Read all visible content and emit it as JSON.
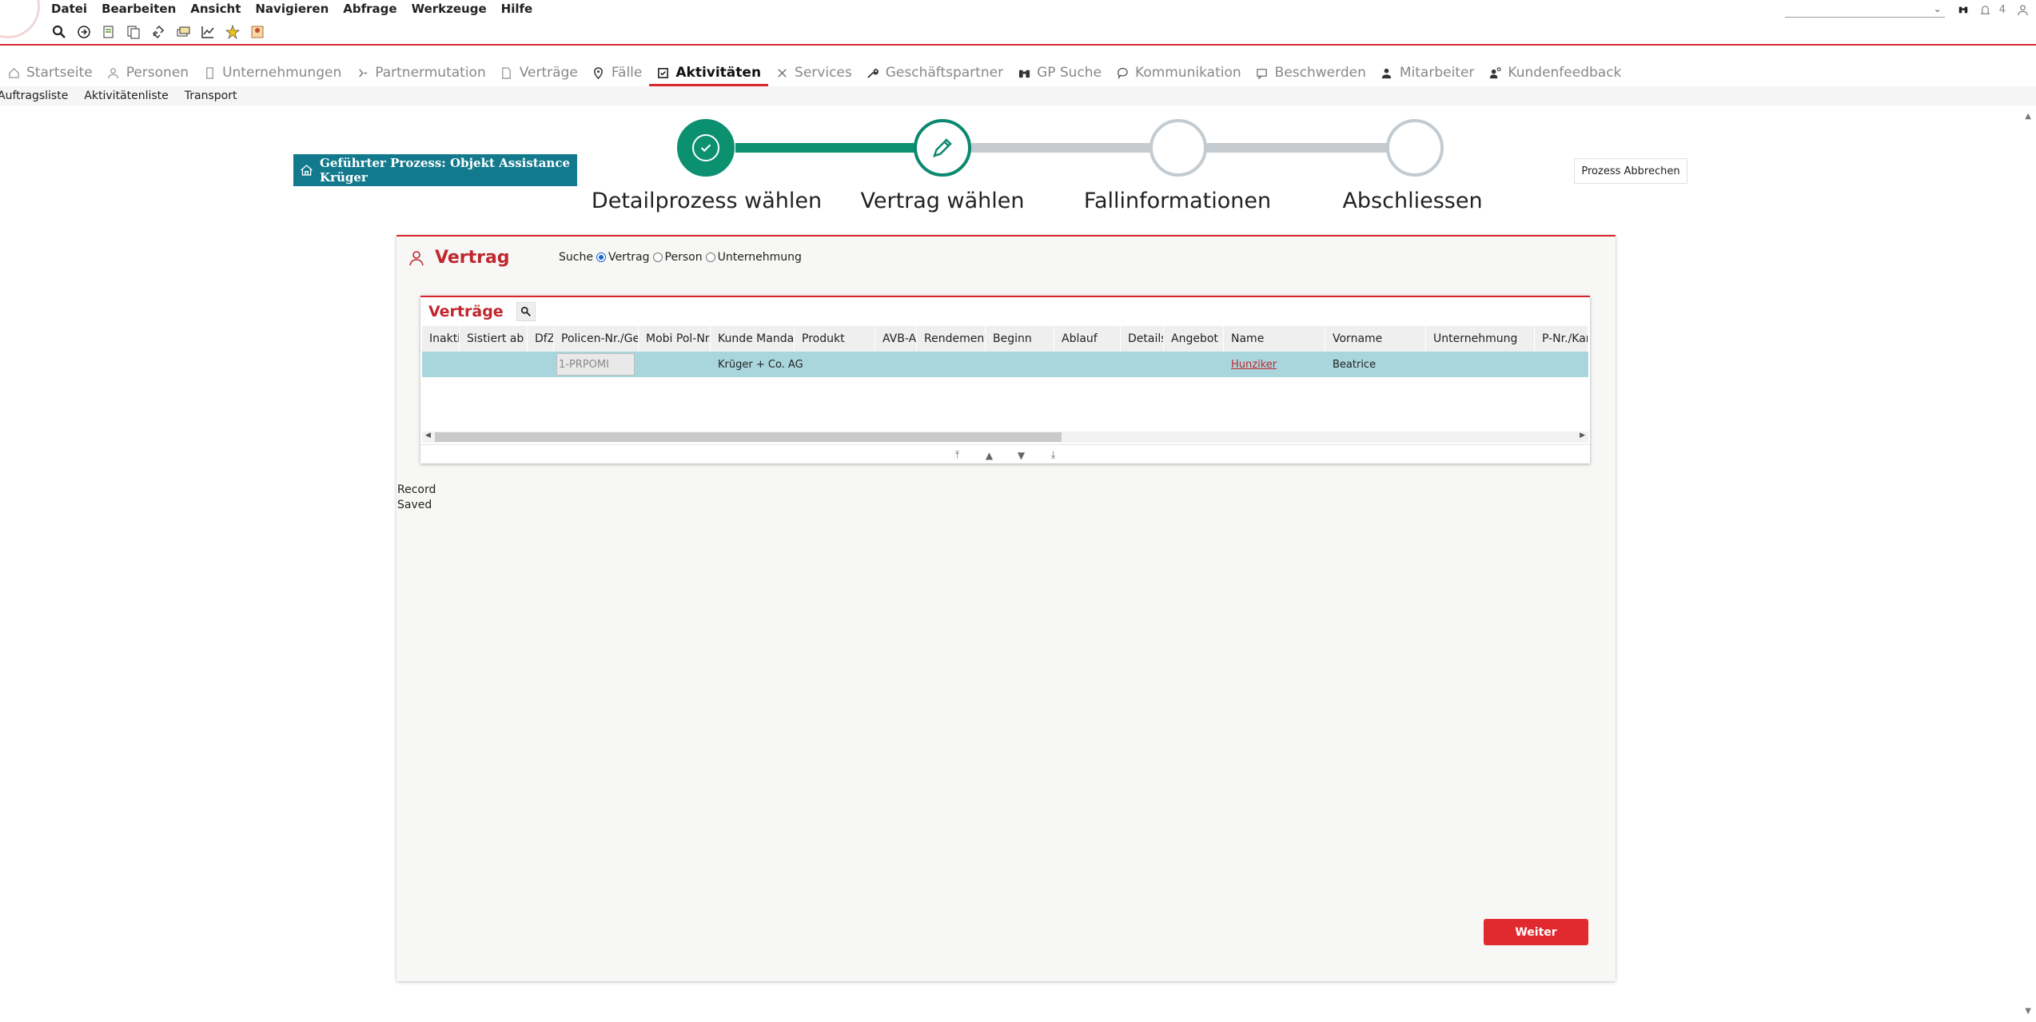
{
  "menu": [
    "Datei",
    "Bearbeiten",
    "Ansicht",
    "Navigieren",
    "Abfrage",
    "Werkzeuge",
    "Hilfe"
  ],
  "toolbar_icons": [
    "search-icon",
    "forward-icon",
    "new-record-icon",
    "copy-record-icon",
    "link-icon",
    "report-icon",
    "chart-icon",
    "favorite-icon",
    "user-group-icon"
  ],
  "top_right": {
    "notification_count": "4"
  },
  "nav": [
    {
      "label": "Startseite",
      "icon": "home-icon"
    },
    {
      "label": "Personen",
      "icon": "person-icon"
    },
    {
      "label": "Unternehmungen",
      "icon": "building-icon"
    },
    {
      "label": "Partnermutation",
      "icon": "merge-icon"
    },
    {
      "label": "Verträge",
      "icon": "document-icon"
    },
    {
      "label": "Fälle",
      "icon": "pin-icon"
    },
    {
      "label": "Aktivitäten",
      "icon": "checklist-icon"
    },
    {
      "label": "Services",
      "icon": "tools-icon"
    },
    {
      "label": "Geschäftspartner",
      "icon": "wrench-icon"
    },
    {
      "label": "GP Suche",
      "icon": "binoculars-icon"
    },
    {
      "label": "Kommunikation",
      "icon": "chat-icon"
    },
    {
      "label": "Beschwerden",
      "icon": "message-icon"
    },
    {
      "label": "Mitarbeiter",
      "icon": "employee-icon"
    },
    {
      "label": "Kundenfeedback",
      "icon": "feedback-icon"
    }
  ],
  "subnav": [
    "Auftragsliste",
    "Aktivitätenliste",
    "Transport"
  ],
  "guided": {
    "title": "Geführter Prozess: Objekt Assistance Krüger"
  },
  "steps": [
    "Detailprozess wählen",
    "Vertrag wählen",
    "Fallinformationen",
    "Abschliessen"
  ],
  "abort_label": "Prozess Abbrechen",
  "panel": {
    "title": "Vertrag",
    "search_label": "Suche",
    "search_options": [
      "Vertrag",
      "Person",
      "Unternehmung"
    ],
    "selected_option": "Vertrag"
  },
  "applet": {
    "title": "Verträge",
    "columns": [
      "Inaktiv",
      "Sistiert ab",
      "DfZ",
      "Policen-Nr./Gesch",
      "Mobi Pol-Nr./",
      "Kunde Mandant",
      "Produkt",
      "AVB-Au",
      "Rendement",
      "Beginn",
      "Ablauf",
      "Details",
      "Angebot",
      "Name",
      "Vorname",
      "Unternehmung",
      "P-Nr./Kar"
    ],
    "row": {
      "police": "1-PRPOMI",
      "kunde": "Krüger + Co. AG",
      "name": "Hunziker",
      "vorname": "Beatrice"
    }
  },
  "status": "Record Saved",
  "next_label": "Weiter",
  "colors": {
    "accent": "#d9272e",
    "step_done": "#0b9070",
    "step_pending": "#c3cbd0",
    "banner": "#137a8d",
    "selected_row": "#a9d5dd"
  }
}
